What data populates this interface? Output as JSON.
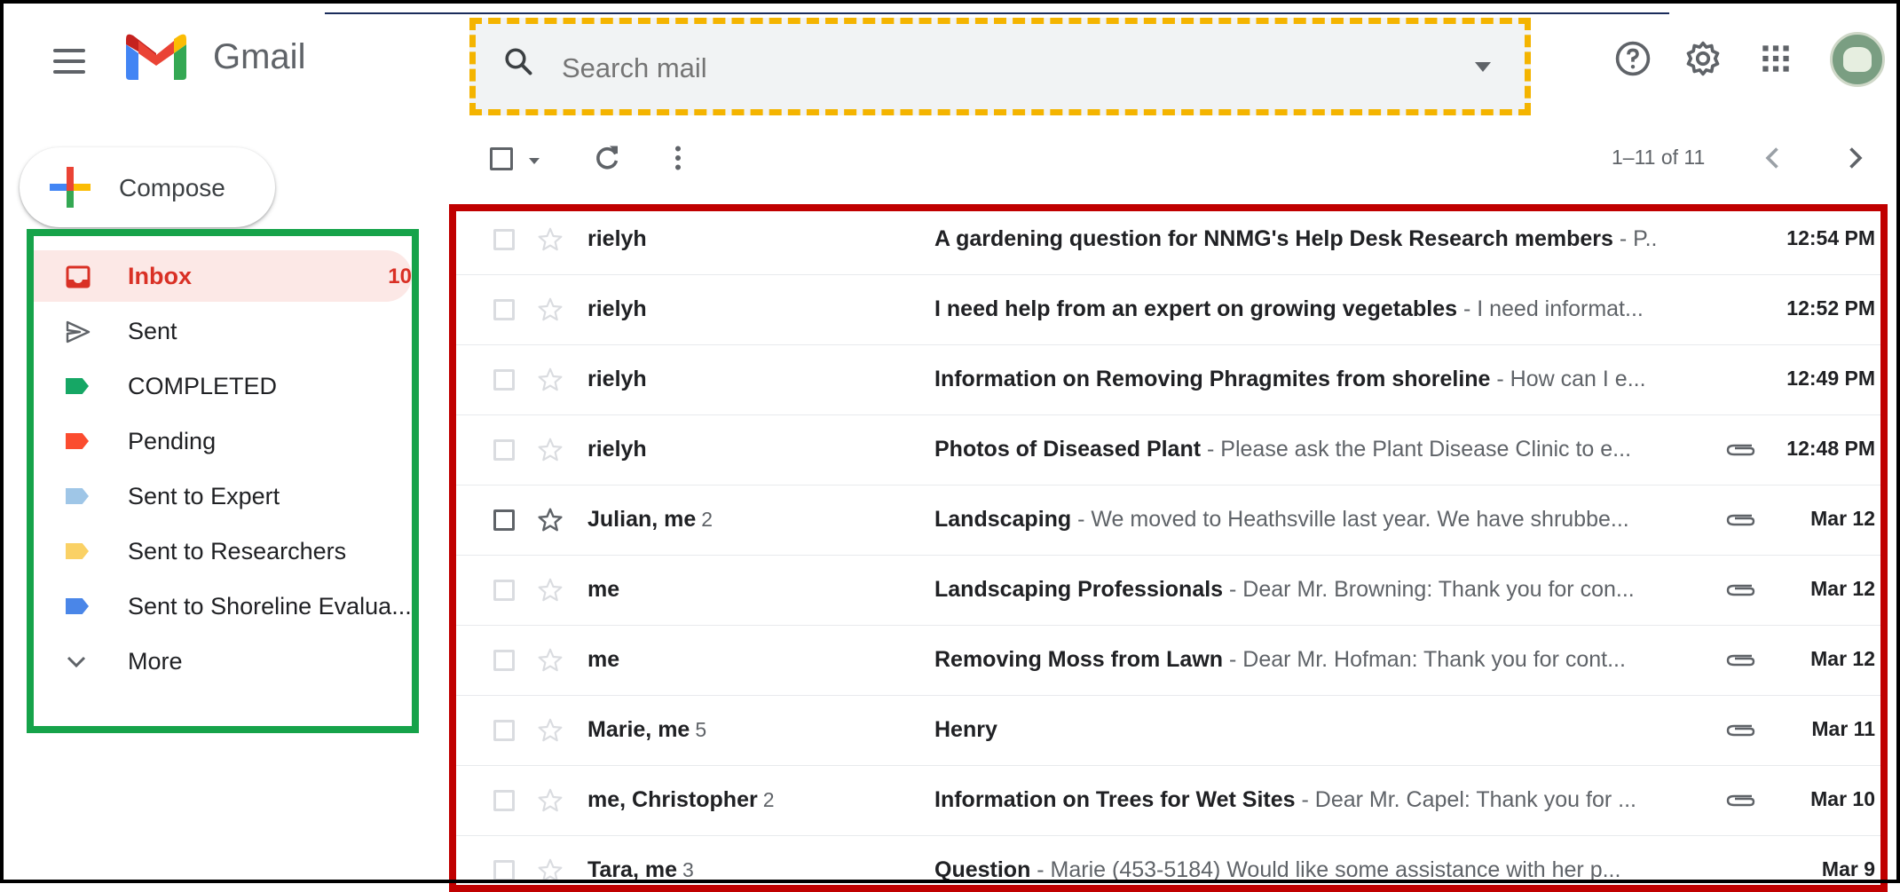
{
  "header": {
    "brand": "Gmail",
    "search_placeholder": "Search mail"
  },
  "compose": {
    "label": "Compose"
  },
  "sidebar": {
    "items": [
      {
        "label": "Inbox",
        "count": "10",
        "color": "#d93025"
      },
      {
        "label": "Sent"
      },
      {
        "label": "COMPLETED",
        "color": "#16a765"
      },
      {
        "label": "Pending",
        "color": "#fb4c2f"
      },
      {
        "label": "Sent to Expert",
        "color": "#9fc6e7"
      },
      {
        "label": "Sent to Researchers",
        "color": "#fad165"
      },
      {
        "label": "Sent to Shoreline Evalua...",
        "color": "#4a86e8"
      },
      {
        "label": "More"
      }
    ]
  },
  "toolbar": {
    "range": "1–11 of 11"
  },
  "emails": [
    {
      "sender": "rielyh",
      "count": "",
      "subject": "A gardening question for NNMG's Help Desk Research members",
      "snippet": " - P..",
      "date": "12:54 PM",
      "attachment": false
    },
    {
      "sender": "rielyh",
      "count": "",
      "subject": "I need help from an expert on growing vegetables",
      "snippet": " - I need informat...",
      "date": "12:52 PM",
      "attachment": false
    },
    {
      "sender": "rielyh",
      "count": "",
      "subject": "Information on Removing Phragmites from shoreline",
      "snippet": " - How can I e...",
      "date": "12:49 PM",
      "attachment": false
    },
    {
      "sender": "rielyh",
      "count": "",
      "subject": "Photos of Diseased Plant",
      "snippet": " - Please ask the Plant Disease Clinic to e...",
      "date": "12:48 PM",
      "attachment": true
    },
    {
      "sender": "Julian, me",
      "count": "2",
      "subject": "Landscaping",
      "snippet": " - We moved to Heathsville last year. We have shrubbe...",
      "date": "Mar 12",
      "attachment": true
    },
    {
      "sender": "me",
      "count": "",
      "subject": "Landscaping Professionals",
      "snippet": " - Dear Mr. Browning: Thank you for con...",
      "date": "Mar 12",
      "attachment": true
    },
    {
      "sender": "me",
      "count": "",
      "subject": "Removing Moss from Lawn",
      "snippet": " - Dear Mr. Hofman: Thank you for cont...",
      "date": "Mar 12",
      "attachment": true
    },
    {
      "sender": "Marie, me",
      "count": "5",
      "subject": "Henry",
      "snippet": "",
      "date": "Mar 11",
      "attachment": true
    },
    {
      "sender": "me, Christopher",
      "count": "2",
      "subject": "Information on Trees for Wet Sites",
      "snippet": " - Dear Mr. Capel: Thank you for ...",
      "date": "Mar 10",
      "attachment": true
    },
    {
      "sender": "Tara, me",
      "count": "3",
      "subject": "Question",
      "snippet": " - Marie (453-5184) Would like some assistance with her p...",
      "date": "Mar 9",
      "attachment": false
    }
  ]
}
